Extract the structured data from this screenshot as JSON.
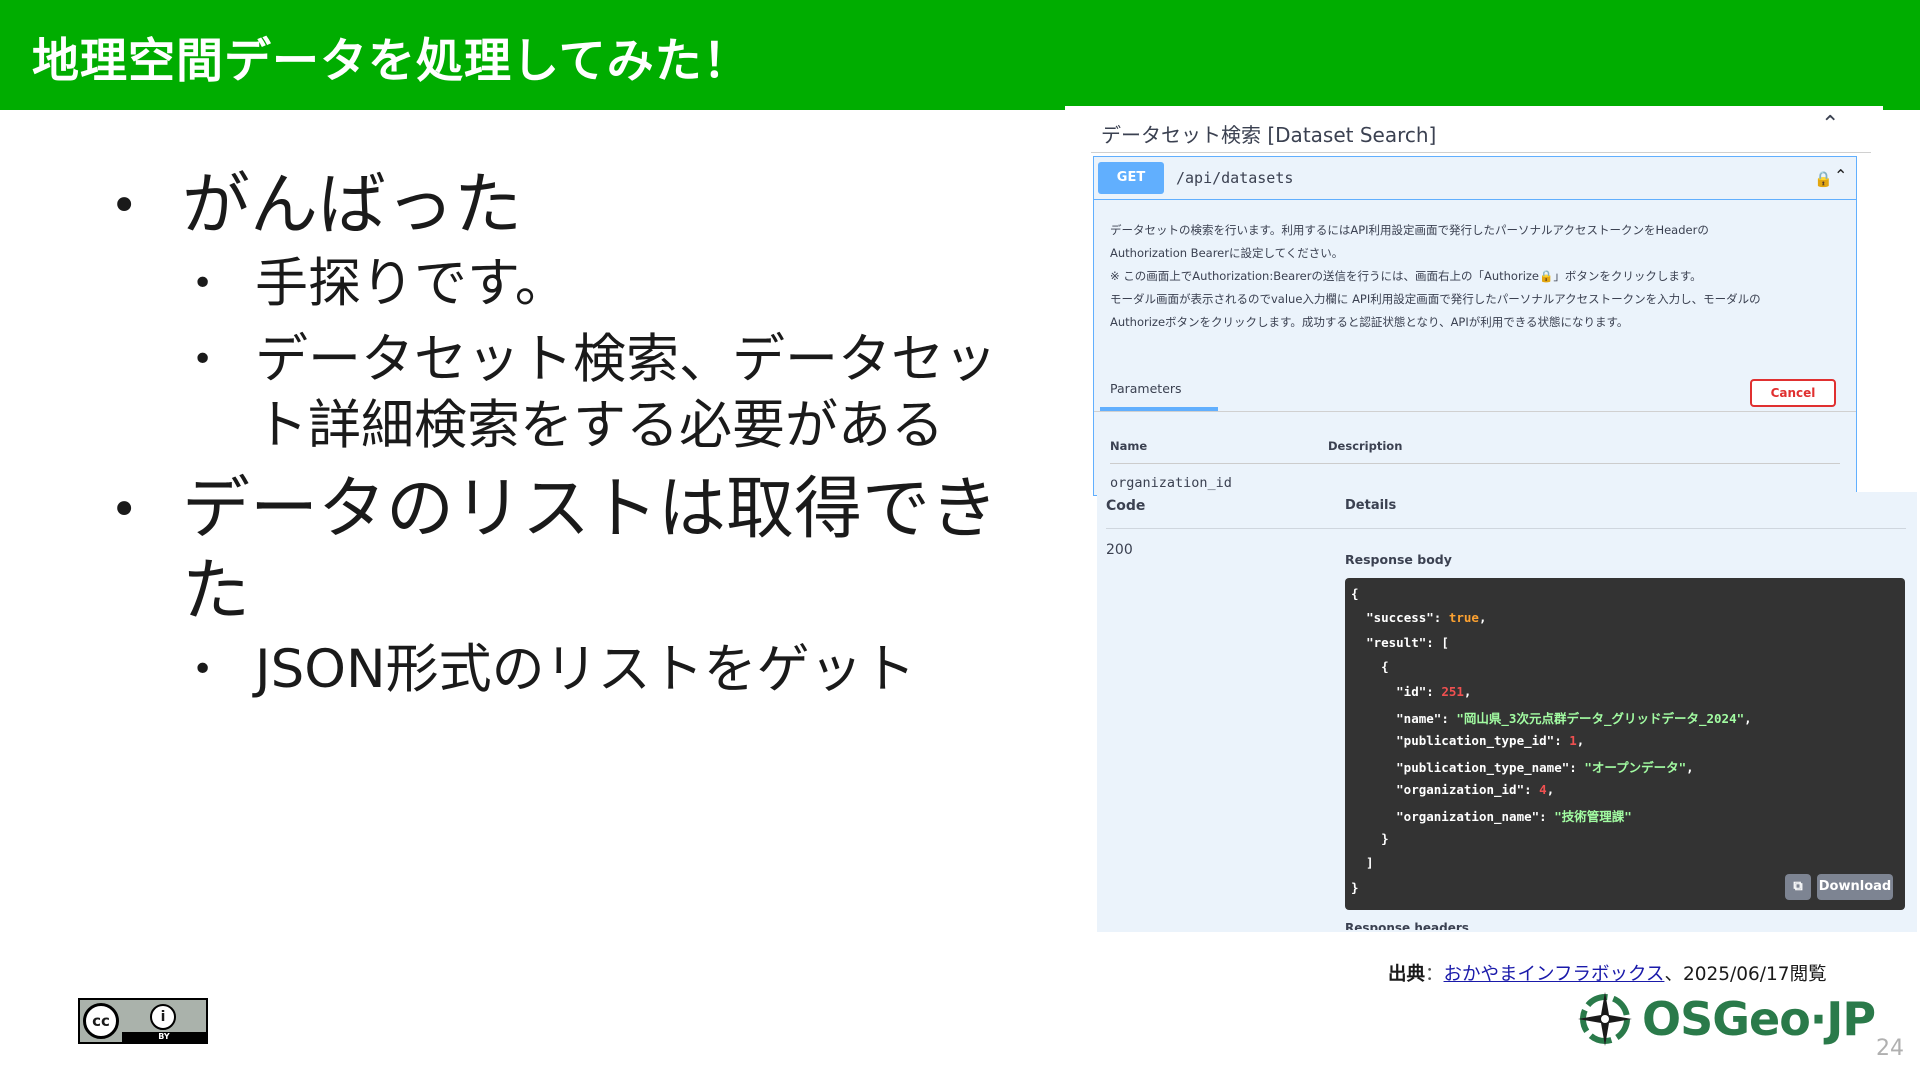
{
  "header": {
    "title": "地理空間データを処理してみた！"
  },
  "bullets": {
    "b1": "がんばった",
    "b1a": "手探りです。",
    "b1b_line1": "データセット検索、データセッ",
    "b1b_line2": "ト詳細検索をする必要がある",
    "b2": "データのリストは取得できた",
    "b2a": "JSON形式のリストをゲット"
  },
  "swagger": {
    "section_title": "データセット検索 [Dataset Search]",
    "method": "GET",
    "path": "/api/datasets",
    "description": [
      "データセットの検索を行います。利用するにはAPI利用設定画面で発行したパーソナルアクセストークンをHeaderの",
      "Authorization Bearerに設定してください。",
      "※ この画面上でAuthorization:Bearerの送信を行うには、画面右上の「Authorize🔒」ボタンをクリックします。",
      "モーダル画面が表示されるのでvalue入力欄に API利用設定画面で発行したパーソナルアクセストークンを入力し、モーダルの",
      "Authorizeボタンをクリックします。成功すると認証状態となり、APIが利用できる状態になります。"
    ],
    "params_tab": "Parameters",
    "cancel": "Cancel",
    "col_name": "Name",
    "col_description": "Description",
    "param_org_id": "organization_id",
    "resp_code_header": "Code",
    "resp_details_header": "Details",
    "resp_code": "200",
    "resp_body_label": "Response body",
    "json": {
      "success_key": "\"success\"",
      "success_val": "true",
      "result_key": "\"result\"",
      "id_key": "\"id\"",
      "id_val": "251",
      "name_key": "\"name\"",
      "name_val": "\"岡山県_3次元点群データ_グリッドデータ_2024\"",
      "ptid_key": "\"publication_type_id\"",
      "ptid_val": "1",
      "ptname_key": "\"publication_type_name\"",
      "ptname_val": "\"オープンデータ\"",
      "orgid_key": "\"organization_id\"",
      "orgid_val": "4",
      "orgname_key": "\"organization_name\"",
      "orgname_val": "\"技術管理課\""
    },
    "download": "Download",
    "resp_headers_label": "Response headers"
  },
  "citation": {
    "label": "出典",
    "sep": "：",
    "link_text": "おかやまインフラボックス",
    "date": "、2025/06/17閲覧"
  },
  "cc_badge": {
    "cc": "cc",
    "by": "BY",
    "icon": "cc-by-icon"
  },
  "logo": {
    "text": "OSGeo·JP"
  },
  "page_number": "24"
}
